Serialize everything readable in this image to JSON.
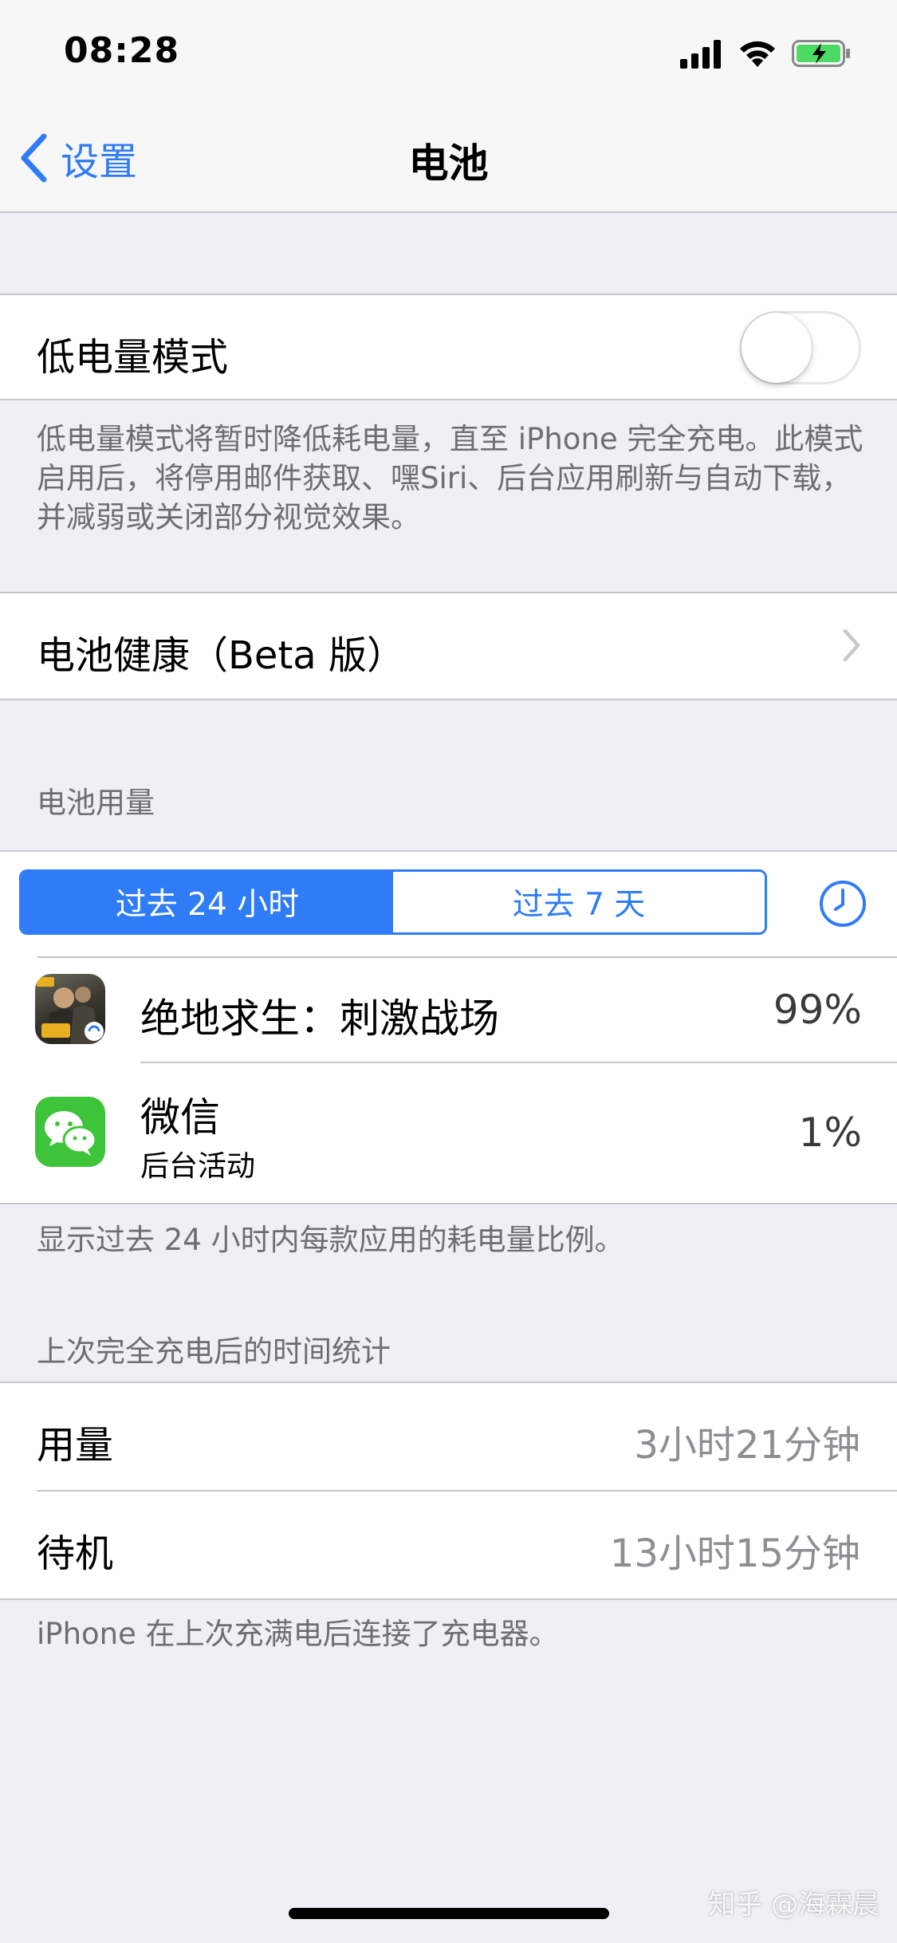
{
  "status_bar": {
    "time": "08:28"
  },
  "nav": {
    "back_label": "设置",
    "title": "电池"
  },
  "low_power": {
    "label": "低电量模式",
    "enabled": false,
    "footer": "低电量模式将暂时降低耗电量，直至 iPhone 完全充电。此模式启用后，将停用邮件获取、嘿Siri、后台应用刷新与自动下载，并减弱或关闭部分视觉效果。"
  },
  "battery_health": {
    "label": "电池健康（Beta 版）"
  },
  "usage": {
    "header": "电池用量",
    "segments": [
      "过去 24 小时",
      "过去 7 天"
    ],
    "selected_segment": "过去 24 小时",
    "apps": [
      {
        "name": "绝地求生：刺激战场",
        "subtitle": "",
        "percent": "99%",
        "icon": "pubg-app-icon"
      },
      {
        "name": "微信",
        "subtitle": "后台活动",
        "percent": "1%",
        "icon": "wechat-app-icon"
      }
    ],
    "footer": "显示过去 24 小时内每款应用的耗电量比例。"
  },
  "since_charge": {
    "header": "上次完全充电后的时间统计",
    "rows": [
      {
        "label": "用量",
        "value": "3小时21分钟"
      },
      {
        "label": "待机",
        "value": "13小时15分钟"
      }
    ],
    "footer": "iPhone 在上次充满电后连接了充电器。"
  },
  "watermark": "知乎 @海霖晨",
  "colors": {
    "accent": "#2f7cf6",
    "battery_green": "#4cd964",
    "background": "#efeff4"
  }
}
